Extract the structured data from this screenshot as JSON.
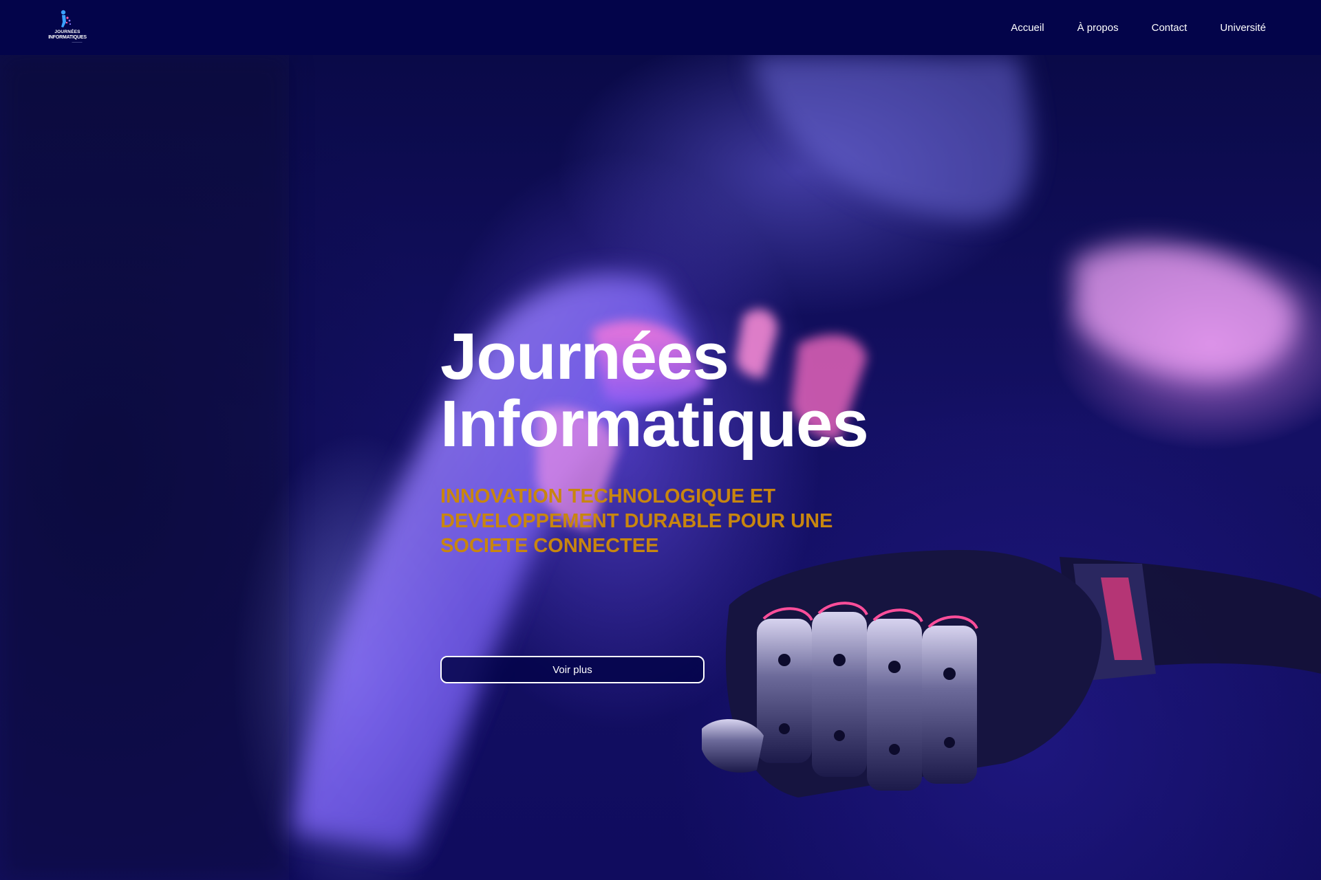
{
  "navbar": {
    "logo": {
      "line1": "JOURNÉES",
      "line2": "INFORMATIQUES",
      "line3": "—————"
    },
    "links": [
      {
        "label": "Accueil"
      },
      {
        "label": "À propos"
      },
      {
        "label": "Contact"
      },
      {
        "label": "Université"
      }
    ]
  },
  "hero": {
    "title_line1": "Journées",
    "title_line2": "Informatiques",
    "subtitle": "INNOVATION TECHNOLOGIQUE ET DEVELOPPEMENT DURABLE POUR UNE SOCIETE CONNECTEE",
    "cta_label": "Voir plus"
  },
  "colors": {
    "navbar_bg": "#03044a",
    "accent_gold": "#c8860f",
    "text_white": "#ffffff"
  }
}
